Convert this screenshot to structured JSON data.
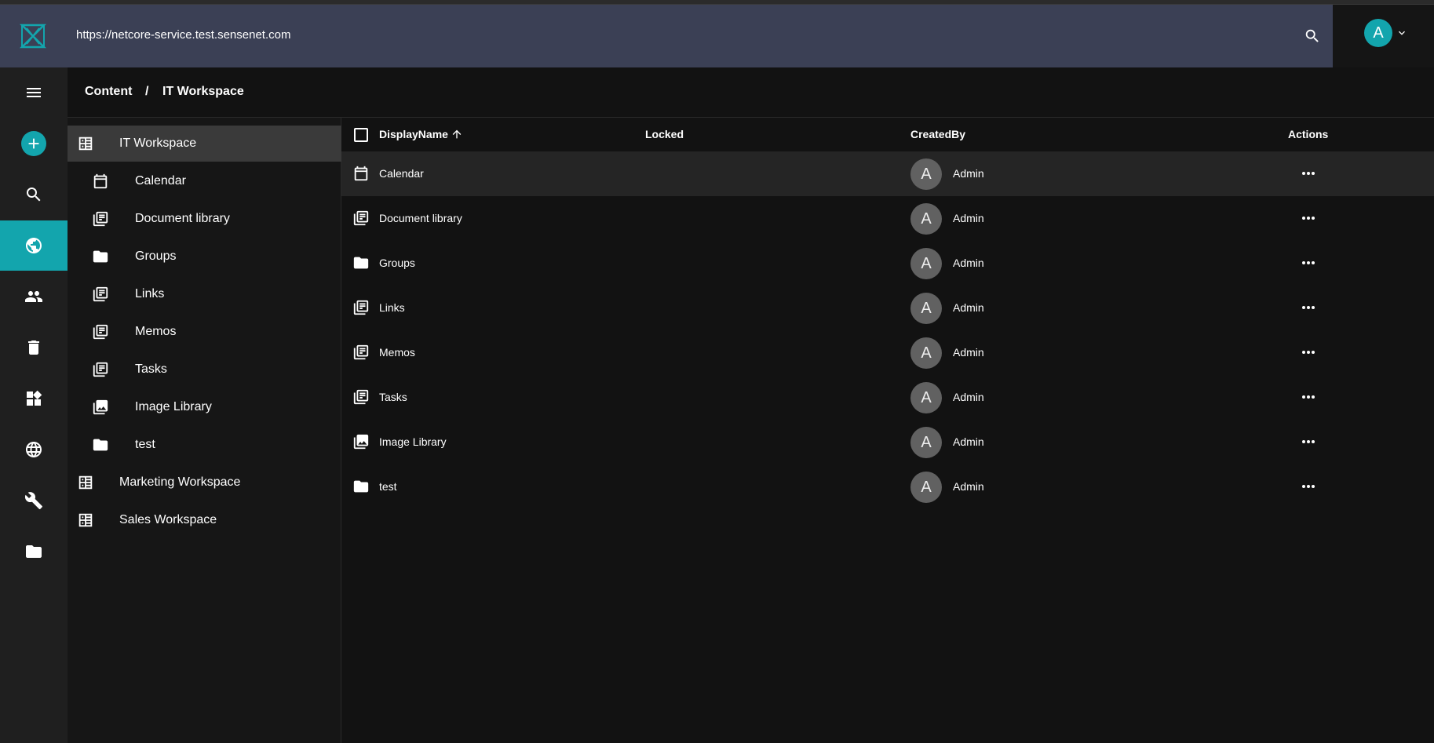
{
  "header": {
    "url": "https://netcore-service.test.sensenet.com",
    "avatar_letter": "A",
    "accent_color": "#13a5ad"
  },
  "leftnav": {
    "icons": [
      "menu-icon",
      "add-icon",
      "search-icon",
      "content-globe-icon",
      "users-icon",
      "trash-icon",
      "widgets-icon",
      "localization-globe-icon",
      "wrench-icon",
      "folder-icon"
    ],
    "active": "content-globe-icon"
  },
  "breadcrumb": {
    "items": [
      "Content",
      "IT Workspace"
    ],
    "separator": "/"
  },
  "tree": {
    "items": [
      {
        "label": "IT Workspace",
        "icon": "workspace-icon"
      },
      {
        "label": "Calendar",
        "icon": "calendar-icon"
      },
      {
        "label": "Document library",
        "icon": "library-icon"
      },
      {
        "label": "Groups",
        "icon": "folder-icon"
      },
      {
        "label": "Links",
        "icon": "library-icon"
      },
      {
        "label": "Memos",
        "icon": "library-icon"
      },
      {
        "label": "Tasks",
        "icon": "library-icon"
      },
      {
        "label": "Image Library",
        "icon": "image-library-icon"
      },
      {
        "label": "test",
        "icon": "folder-icon"
      },
      {
        "label": "Marketing Workspace",
        "icon": "workspace-icon"
      },
      {
        "label": "Sales Workspace",
        "icon": "workspace-icon"
      }
    ],
    "selected": "IT Workspace"
  },
  "grid": {
    "columns": [
      "DisplayName",
      "Locked",
      "CreatedBy",
      "Actions"
    ],
    "sort_column": "DisplayName",
    "sort_direction": "ascending",
    "rows": [
      {
        "name": "Calendar",
        "icon": "calendar-icon",
        "avatar": "A",
        "created_by": "Admin"
      },
      {
        "name": "Document library",
        "icon": "library-icon",
        "avatar": "A",
        "created_by": "Admin"
      },
      {
        "name": "Groups",
        "icon": "folder-icon",
        "avatar": "A",
        "created_by": "Admin"
      },
      {
        "name": "Links",
        "icon": "library-icon",
        "avatar": "A",
        "created_by": "Admin"
      },
      {
        "name": "Memos",
        "icon": "library-icon",
        "avatar": "A",
        "created_by": "Admin"
      },
      {
        "name": "Tasks",
        "icon": "library-icon",
        "avatar": "A",
        "created_by": "Admin"
      },
      {
        "name": "Image Library",
        "icon": "image-library-icon",
        "avatar": "A",
        "created_by": "Admin"
      },
      {
        "name": "test",
        "icon": "folder-icon",
        "avatar": "A",
        "created_by": "Admin"
      }
    ]
  }
}
